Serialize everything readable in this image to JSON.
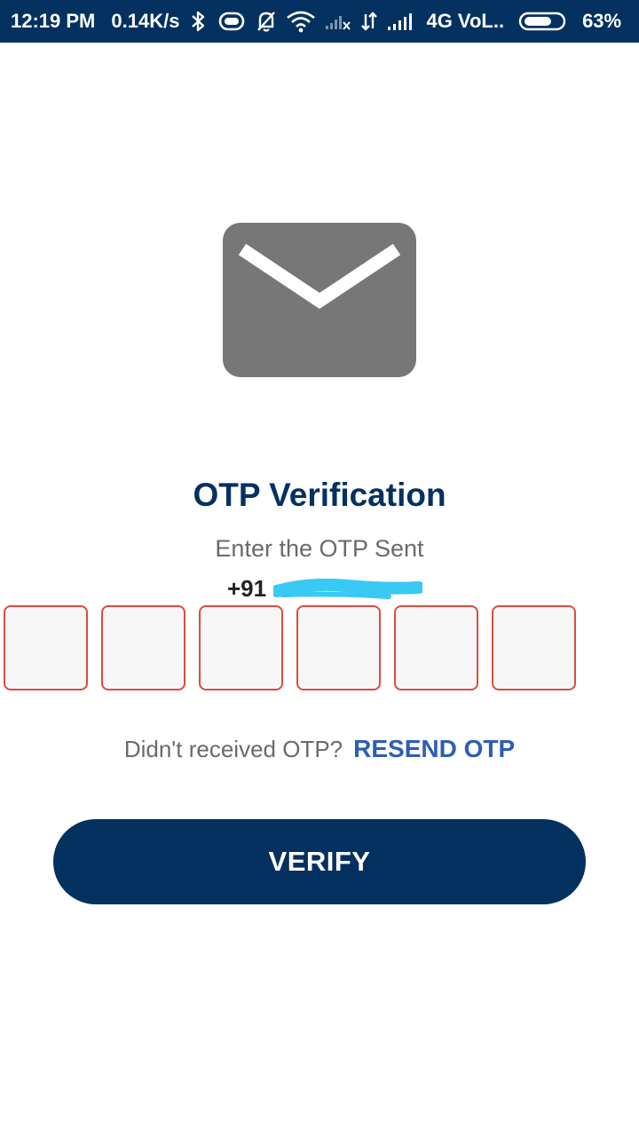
{
  "status_bar": {
    "time": "12:19 PM",
    "speed": "0.14K/s",
    "network": "4G VoL..",
    "battery": "63%",
    "icons": [
      "bluetooth-icon",
      "vibrate-icon",
      "mute-bell-icon",
      "wifi-icon",
      "no-signal-icon",
      "data-arrows-icon",
      "signal-icon",
      "battery-icon"
    ]
  },
  "main": {
    "icon": "envelope-icon",
    "title": "OTP Verification",
    "subtitle": "Enter the OTP Sent",
    "phone_prefix": "+91",
    "otp_boxes": [
      "",
      "",
      "",
      "",
      "",
      ""
    ],
    "resend_question": "Didn't received OTP?",
    "resend_label": "RESEND OTP",
    "verify_label": "VERIFY"
  },
  "colors": {
    "brand": "#04315f",
    "link": "#2e5db8",
    "otp_border": "#dd4b40",
    "envelope": "#777777",
    "redaction": "#38c9f5"
  }
}
